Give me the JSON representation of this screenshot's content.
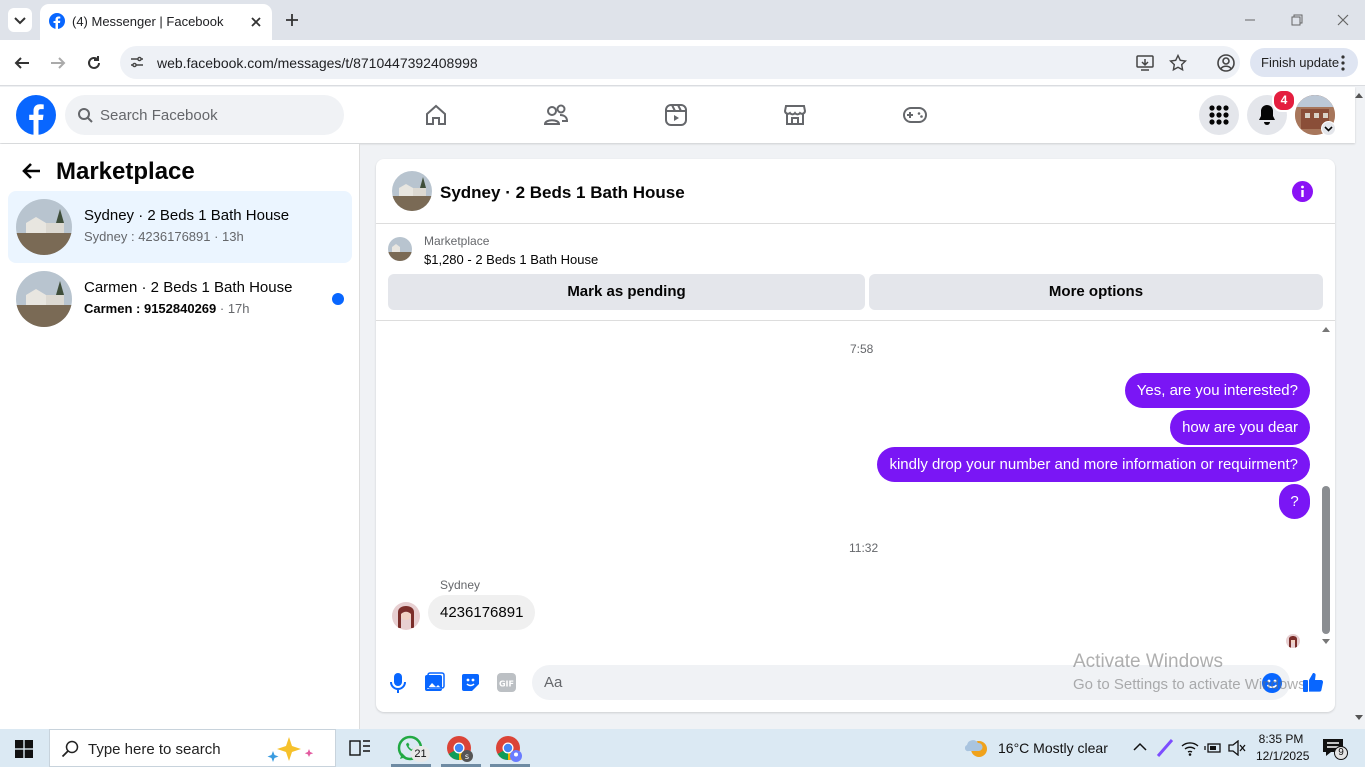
{
  "browser": {
    "tab_title": "(4) Messenger | Facebook",
    "url": "web.facebook.com/messages/t/8710447392408998",
    "finish_update": "Finish update"
  },
  "fb": {
    "search_placeholder": "Search Facebook",
    "notification_count": "4"
  },
  "sidebar": {
    "title": "Marketplace",
    "conversations": [
      {
        "title": "Sydney · 2 Beds 1 Bath House",
        "subtitle": "Sydney : 4236176891 · 13h"
      },
      {
        "title": "Carmen · 2 Beds 1 Bath House",
        "subtitle_main": "Carmen : 9152840269",
        "subtitle_time": " · 17h"
      }
    ]
  },
  "chat": {
    "title": "Sydney · 2 Beds 1 Bath House",
    "listing_label": "Marketplace",
    "listing_desc": "$1,280 - 2 Beds 1 Bath House",
    "mark_pending": "Mark as pending",
    "more_options": "More options",
    "time1": "7:58",
    "sent": [
      "Yes, are you interested?",
      "how are you dear",
      "kindly  drop your number and more information or requirment?",
      "?"
    ],
    "time2": "11:32",
    "sender_name": "Sydney",
    "received": "4236176891",
    "input_placeholder": "Aa"
  },
  "windows": {
    "activate_title": "Activate Windows",
    "activate_sub": "Go to Settings to activate Windows."
  },
  "taskbar": {
    "search_placeholder": "Type here to search",
    "whatsapp_badge": "21",
    "weather": "16°C  Mostly clear",
    "time": "8:35 PM",
    "date": "12/1/2025",
    "notif_count": "9"
  },
  "colors": {
    "fb_blue": "#0866ff",
    "bubble": "#7a16f5",
    "badge_red": "#e41e3f"
  }
}
